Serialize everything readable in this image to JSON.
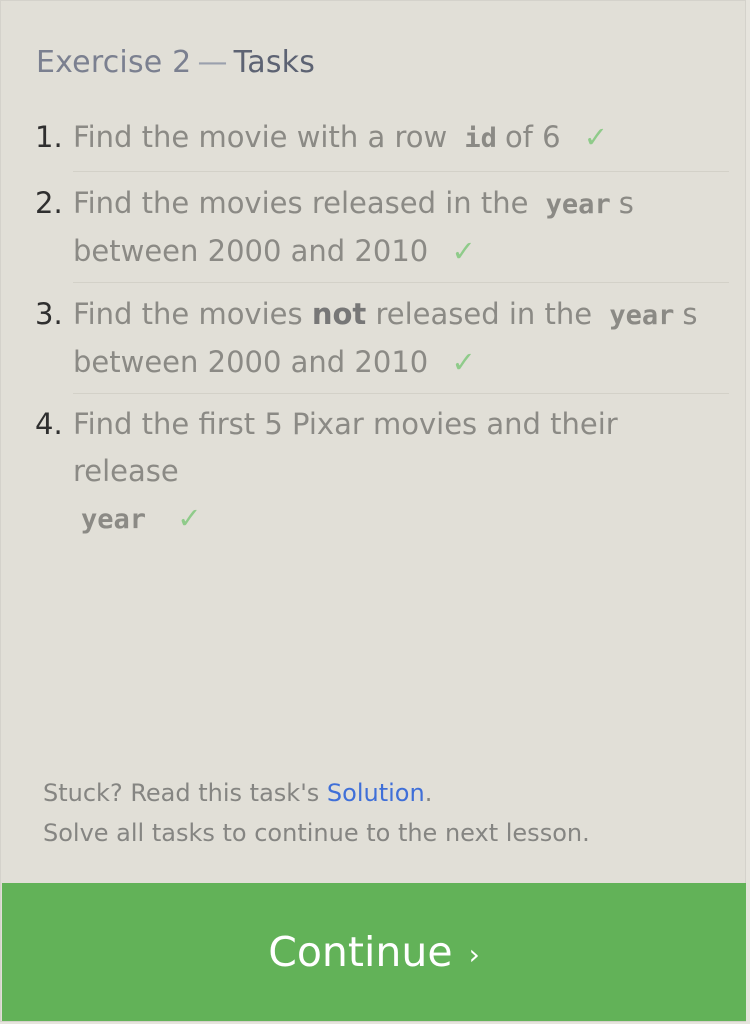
{
  "header": {
    "exercise": "Exercise 2",
    "dash": "—",
    "tasks_label": "Tasks"
  },
  "tasks": [
    {
      "number": "1.",
      "parts": {
        "a": "Find the movie with a row",
        "code": "id",
        "b": "of 6"
      },
      "check": "✓"
    },
    {
      "number": "2.",
      "parts": {
        "a": "Find the movies released in the",
        "code": "year",
        "b": "s",
        "c": "between 2000 and 2010"
      },
      "check": "✓"
    },
    {
      "number": "3.",
      "parts": {
        "a": "Find the movies",
        "bold": "not",
        "b": "released in the",
        "code": "year",
        "c": "s",
        "d": "between 2000 and 2010"
      },
      "check": "✓"
    },
    {
      "number": "4.",
      "parts": {
        "a": "Find the first 5 Pixar movies and their release",
        "code": "year"
      },
      "check": "✓"
    }
  ],
  "footer": {
    "stuck_prefix": "Stuck? Read this task's ",
    "solution_link": "Solution",
    "stuck_suffix": ".",
    "solve_all": "Solve all tasks to continue to the next lesson."
  },
  "continue_button": {
    "label": "Continue",
    "chevron": "›",
    "color": "#62b258"
  },
  "colors": {
    "check": "#8fcb8a",
    "link": "#3f6fd8"
  }
}
